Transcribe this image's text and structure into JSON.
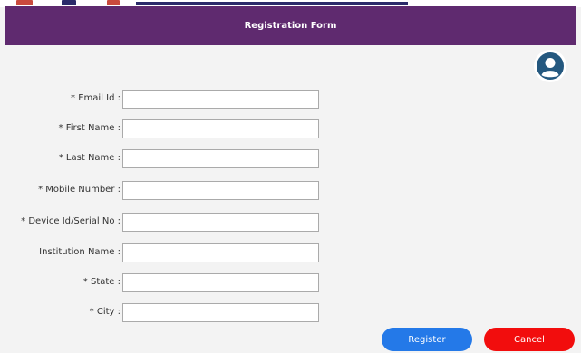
{
  "header": {
    "title": "Registration Form"
  },
  "avatar": {
    "icon": "user-avatar-icon",
    "color": "#24587f"
  },
  "form": {
    "fields": [
      {
        "label": "* Email Id :",
        "value": ""
      },
      {
        "label": "* First Name :",
        "value": ""
      },
      {
        "label": "* Last Name :",
        "value": ""
      },
      {
        "label": "* Mobile Number :",
        "value": ""
      },
      {
        "label": "* Device Id/Serial No :",
        "value": ""
      },
      {
        "label": "Institution Name :",
        "value": ""
      },
      {
        "label": "* State :",
        "value": ""
      },
      {
        "label": "* City :",
        "value": ""
      }
    ]
  },
  "actions": {
    "register_label": "Register",
    "cancel_label": "Cancel"
  },
  "colors": {
    "header": "#5f2a6f",
    "register": "#2479e8",
    "cancel": "#f20d0d"
  }
}
